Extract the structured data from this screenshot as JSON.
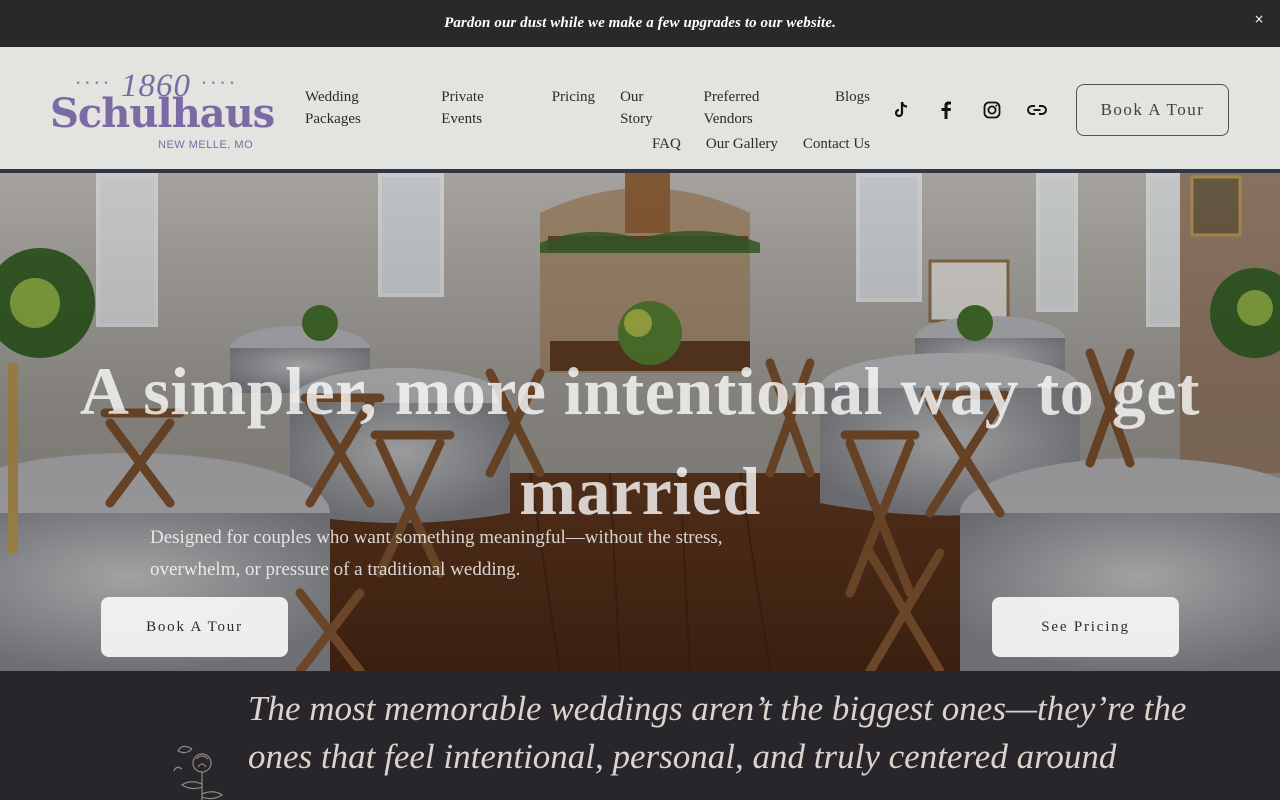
{
  "announcement": {
    "text": "Pardon our dust while we make a few upgrades to our website.",
    "close_glyph": "×"
  },
  "logo": {
    "year": "1860",
    "name": "Schulhaus",
    "location": "NEW MELLE, MO",
    "color": "#7a6ba5"
  },
  "nav": {
    "row1": [
      "Wedding Packages",
      "Private Events",
      "Pricing",
      "Our Story",
      "Preferred Vendors",
      "Blogs"
    ],
    "row2": [
      "FAQ",
      "Our Gallery",
      "Contact Us"
    ]
  },
  "social": [
    "tiktok-icon",
    "facebook-icon",
    "instagram-icon",
    "link-icon"
  ],
  "header_cta": "Book A Tour",
  "hero": {
    "title": "A simpler, more intentional way to get married",
    "subtitle": "Designed for couples who want something meaningful—without the stress, overwhelm, or pressure of a traditional wedding.",
    "btn_left": "Book A Tour",
    "btn_right": "See Pricing"
  },
  "quote": {
    "text": "The most memorable weddings aren’t the biggest ones—they’re the ones that feel intentional, personal, and truly centered around"
  },
  "colors": {
    "announce_bg": "#2a282b",
    "header_bg": "#e3e3df",
    "header_rule": "#2e3648",
    "section_bg": "#28262a"
  }
}
